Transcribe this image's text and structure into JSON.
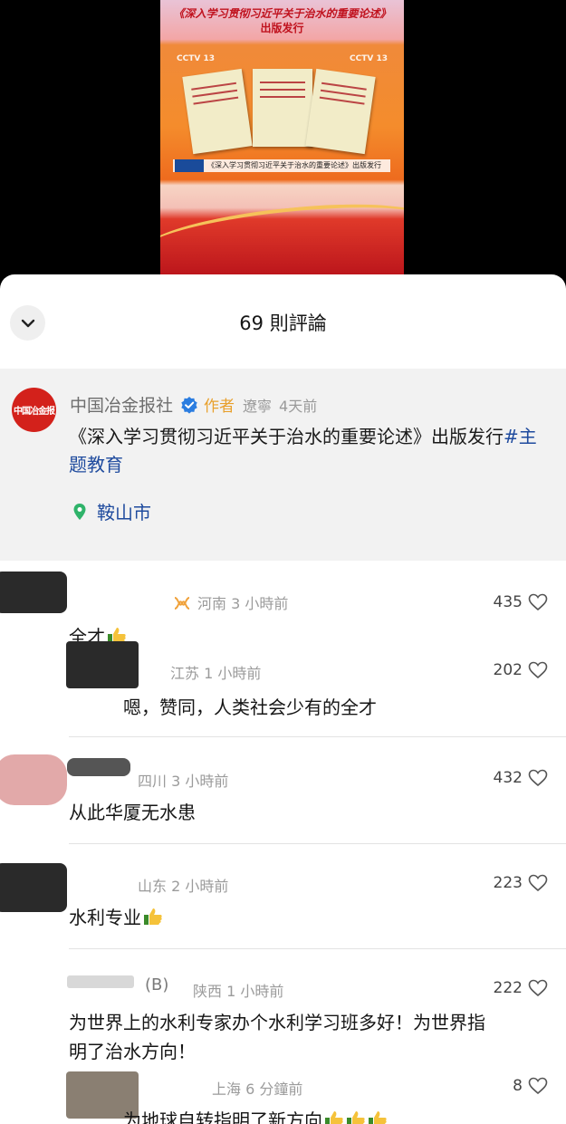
{
  "video": {
    "title_line1": "《深入学习贯彻习近平关于治水的重要论述》",
    "title_line2": "出版发行",
    "cctv_left": "CCTV 13",
    "cctv_right": "CCTV 13",
    "banner": "《深入学习贯彻习近平关于治水的重要论述》出版发行"
  },
  "sheet": {
    "comment_count": "69 則評論"
  },
  "post": {
    "avatar_text": "中国冶金报",
    "author": "中国冶金报社",
    "author_tag": "作者",
    "location": "遼寧",
    "time": "4天前",
    "body": "《深入学习贯彻习近平关于治水的重要论述》出版发行",
    "hashtag": "#主题教育",
    "place": "鞍山市",
    "colors": {
      "link": "#1f4b9e",
      "author_tag": "#e8a02c",
      "verified": "#2b7de0",
      "pin": "#2fb36a"
    }
  },
  "comments": [
    {
      "meta": "河南 3 小時前",
      "text": "全才",
      "likes": "435",
      "has_thumb": true
    },
    {
      "meta": "江苏 1 小時前",
      "text": "嗯，赞同，人类社会少有的全才",
      "likes": "202",
      "reply": true
    },
    {
      "meta": "四川 3 小時前",
      "text": "从此华厦无水患",
      "likes": "432"
    },
    {
      "meta": "山东 2 小時前",
      "text": "水利专业",
      "likes": "223",
      "has_thumb": true
    },
    {
      "name_suffix": "(B)",
      "meta": "陕西 1 小時前",
      "text_line1": "为世界上的水利专家办个水利学习班多好！为世界指",
      "text_line2": "明了治水方向！",
      "likes": "222"
    },
    {
      "meta": "上海 6 分鐘前",
      "text": "为地球自转指明了新方向",
      "likes": "8",
      "reply": true
    }
  ]
}
